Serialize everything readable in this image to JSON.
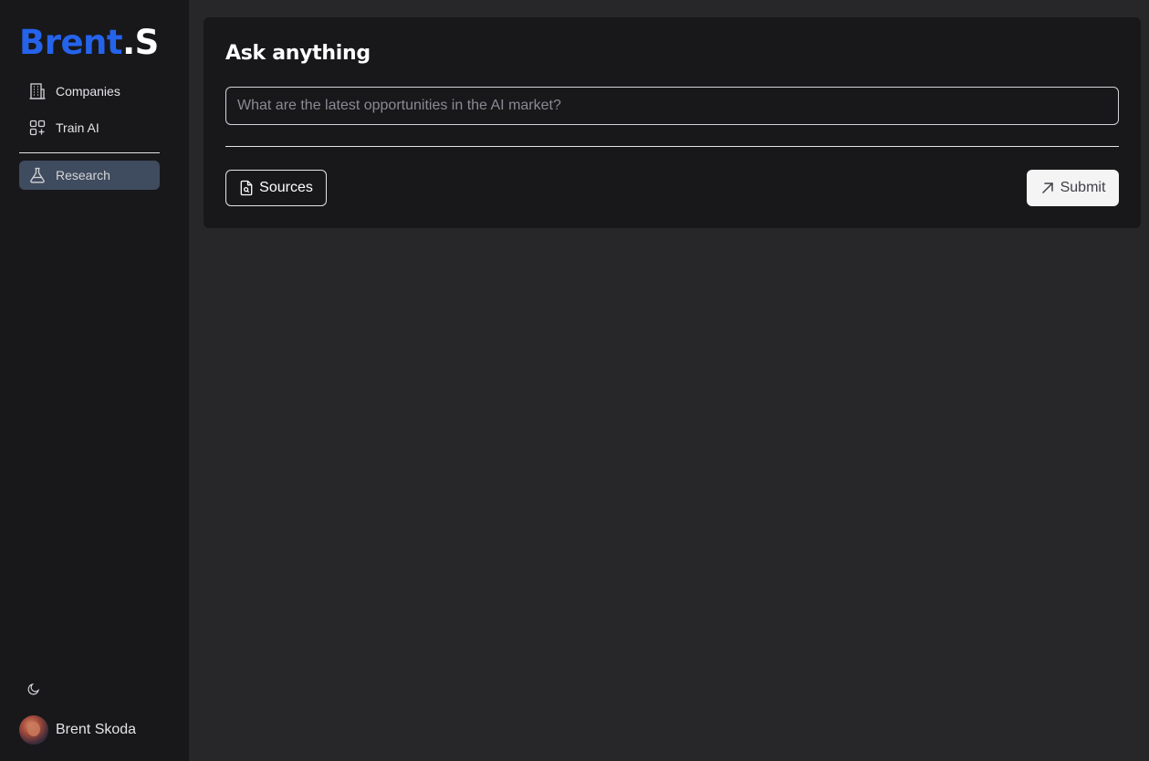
{
  "brand": {
    "name": "Brent",
    "suffix": ".S"
  },
  "sidebar": {
    "items": [
      {
        "label": "Companies",
        "icon": "building-icon"
      },
      {
        "label": "Train AI",
        "icon": "apps-plus-icon"
      },
      {
        "label": "Research",
        "icon": "flask-icon",
        "active": true
      }
    ],
    "theme_icon": "moon-icon",
    "user": {
      "name": "Brent Skoda"
    }
  },
  "main": {
    "title": "Ask anything",
    "query": {
      "value": "",
      "placeholder": "What are the latest opportunities in the AI market?"
    },
    "sources_label": "Sources",
    "submit_label": "Submit"
  },
  "colors": {
    "accent": "#2563eb",
    "sidebar_bg": "#18181b",
    "page_bg": "#27272a",
    "card_bg": "#18181b",
    "active_item_bg": "#3f4b5e"
  }
}
